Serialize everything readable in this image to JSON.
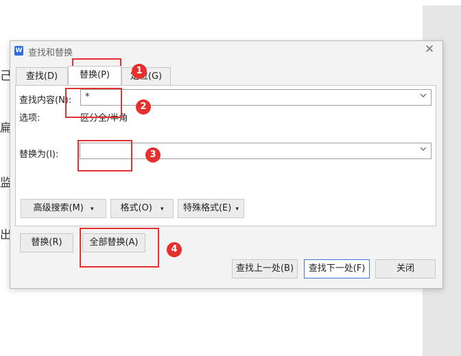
{
  "dialog": {
    "title": "查找和替换",
    "tabs": [
      {
        "label": "查找(D)"
      },
      {
        "label": "替换(P)"
      },
      {
        "label": "定位(G)"
      }
    ],
    "find_label": "查找内容(N):",
    "find_value": "*",
    "options_label": "选项:",
    "options_value": "区分全/半角",
    "replace_label": "替换为(I):",
    "replace_value": "",
    "advanced_search": "高级搜索(M)",
    "format": "格式(O)",
    "special_format": "特殊格式(E)",
    "replace_btn": "替换(R)",
    "replace_all_btn": "全部替换(A)",
    "find_prev_btn": "查找上一处(B)",
    "find_next_btn": "查找下一处(F)",
    "close_btn": "关闭"
  },
  "document_fragments": [
    "己",
    "扁",
    "监",
    "出"
  ],
  "callouts": [
    "1",
    "2",
    "3",
    "4"
  ],
  "colors": {
    "highlight": "#e5302f",
    "accent": "#3a78d6",
    "app_icon": "#2f6fd9"
  },
  "icons": {
    "app": "wps-writer-icon",
    "close": "close-icon"
  }
}
